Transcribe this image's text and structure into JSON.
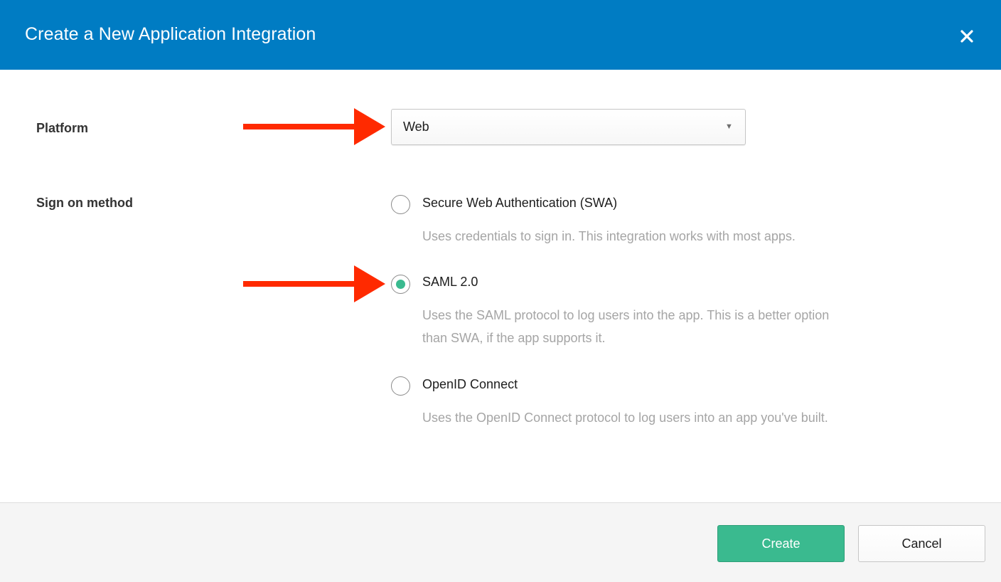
{
  "dialog": {
    "title": "Create a New Application Integration",
    "close_icon": "close-icon"
  },
  "platform": {
    "label": "Platform",
    "selected": "Web",
    "caret_icon": "caret-down-icon"
  },
  "sign_on": {
    "label": "Sign on method",
    "options": [
      {
        "label": "Secure Web Authentication (SWA)",
        "description": "Uses credentials to sign in. This integration works with most apps.",
        "checked": false
      },
      {
        "label": "SAML 2.0",
        "description_line1": "Uses the SAML protocol to log users into the app. This is a better option",
        "description_line2": "than SWA, if the app supports it.",
        "checked": true
      },
      {
        "label": "OpenID Connect",
        "description": "Uses the OpenID Connect protocol to log users into an app you've built.",
        "checked": false
      }
    ]
  },
  "footer": {
    "create_label": "Create",
    "cancel_label": "Cancel"
  },
  "colors": {
    "header": "#007cc3",
    "accent": "#3aba8f",
    "arrow": "#ff2a00",
    "muted_text": "#a5a5a5"
  },
  "icons": {
    "annotation_arrow": "right-arrow-icon"
  }
}
